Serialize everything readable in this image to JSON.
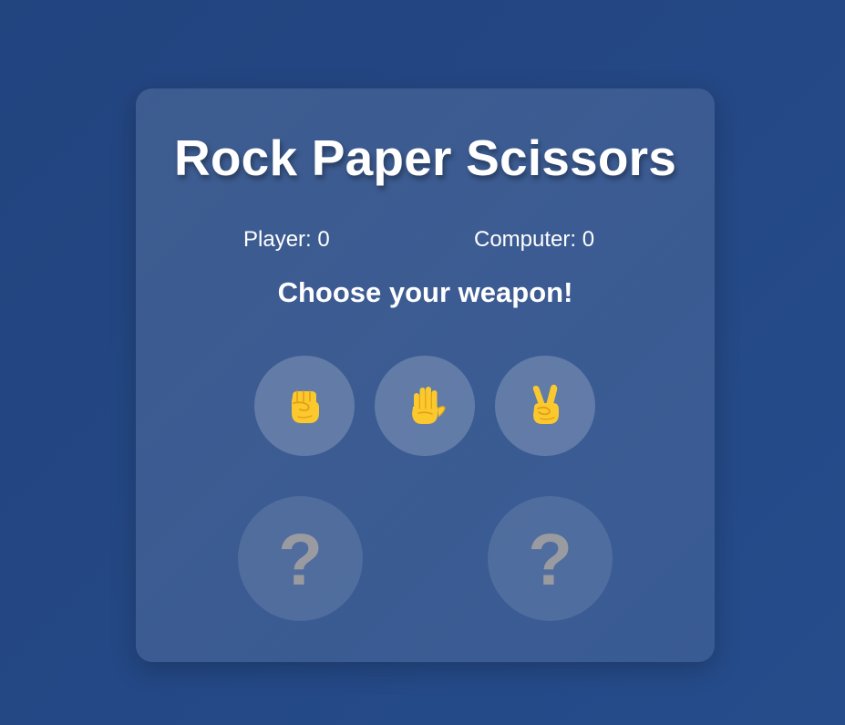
{
  "title": "Rock Paper Scissors",
  "score": {
    "player_label": "Player: 0",
    "computer_label": "Computer: 0"
  },
  "message": "Choose your weapon!",
  "choices": [
    {
      "name": "rock",
      "icon": "raised-fist-icon"
    },
    {
      "name": "paper",
      "icon": "raised-hand-icon"
    },
    {
      "name": "scissors",
      "icon": "victory-hand-icon"
    }
  ],
  "results": {
    "player_choice": "?",
    "computer_choice": "?"
  },
  "colors": {
    "background": "#244886",
    "emoji_skin": "#fbc82e",
    "emoji_shade": "#e0a115",
    "question_mark": "#9a9ba0"
  }
}
